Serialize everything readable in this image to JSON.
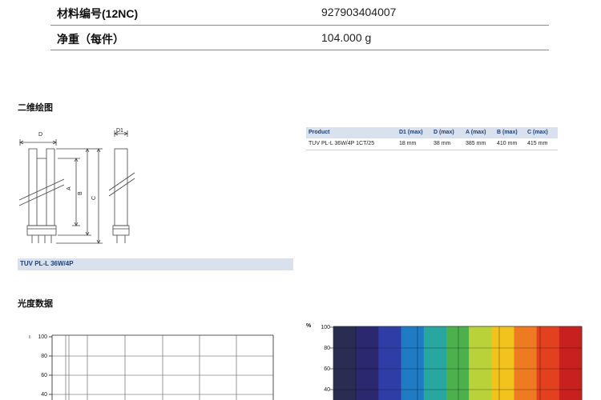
{
  "specs": [
    {
      "label": "材料编号(12NC)",
      "value": "927903404007"
    },
    {
      "label": "净重（每件）",
      "value": "104.000 g"
    }
  ],
  "section_drawing": "二维绘图",
  "section_photometric": "光度数据",
  "drawing": {
    "labels": {
      "d": "D",
      "d1": "D1",
      "a": "A",
      "b": "B",
      "c": "C"
    },
    "caption": "TUV PL-L 36W/4P"
  },
  "dimensions_table": {
    "headers": [
      "Product",
      "D1 (max)",
      "D (max)",
      "A (max)",
      "B (max)",
      "C (max)"
    ],
    "rows": [
      [
        "TUV PL-L 36W/4P 1CT/25",
        "18 mm",
        "38 mm",
        "385 mm",
        "410 mm",
        "415 mm"
      ]
    ]
  },
  "graph_left": {
    "y_ticks": [
      "100",
      "80",
      "60",
      "40"
    ]
  },
  "graph_right": {
    "y_unit": "%",
    "y_ticks": [
      "100",
      "80",
      "60",
      "40"
    ],
    "spectrum_colors": [
      "#2a2d52",
      "#2c2870",
      "#2f3ea6",
      "#1f7bc4",
      "#28a6a0",
      "#4cb04c",
      "#b9d23a",
      "#f2c31c",
      "#ee7b22",
      "#e2401f",
      "#c81f1f"
    ]
  }
}
